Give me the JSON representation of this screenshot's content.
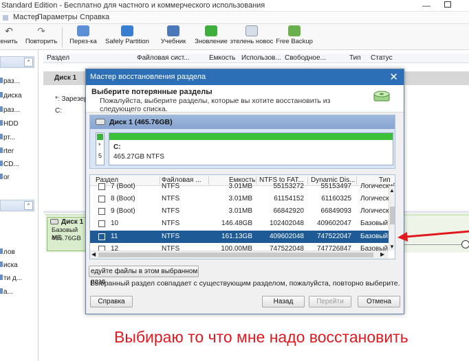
{
  "app": {
    "title": "Standard Edition - Бесплатно для частного и коммерческого использования",
    "menu": [
      "Мастер",
      "Параметры",
      "Справка"
    ],
    "toolbar": [
      "енить",
      "Повторить",
      "Перез-ка",
      "Safely Partition",
      "Учебник",
      "Зновление",
      "зтелень новос",
      "Free Backup"
    ]
  },
  "left_panel": {
    "top_items": [
      "раз...",
      "диска",
      "раз...",
      "HDD",
      "рт...",
      "rter",
      "CD...",
      "or"
    ],
    "bottom_items": [
      "лов",
      "иска",
      "ти д...",
      "а..."
    ]
  },
  "grid": {
    "columns": [
      "Раздел",
      "Файловая сист...",
      "Емкость",
      "Использов...",
      "Свободное...",
      "Тип",
      "Статус"
    ],
    "disk_label": "Диск 1",
    "reserved": "*: Зарезер",
    "c_label": "C:"
  },
  "disk_map": {
    "title": "Диск 1",
    "type": "Базовый МБ",
    "size": "465.76GB"
  },
  "dialog": {
    "title": "Мастер восстановления раздела",
    "heading": "Выберите потерянные разделы",
    "instruction": "Пожалуйста, выберите разделы, которые вы хотите восстановить из следующего списка.",
    "disk_header": "Диск 1 (465.76GB)",
    "left_box": [
      "*",
      "5"
    ],
    "partition_label": "C:",
    "partition_info": "465.27GB NTFS",
    "table_columns": [
      "Раздел",
      "Файловая ...",
      "Емкость",
      "NTFS to FAT...",
      "Dynamic Dis...",
      "Тип"
    ],
    "rows": [
      {
        "name": "7 (Boot)",
        "fs": "NTFS",
        "size": "3.01MB",
        "ntfs": "55153272",
        "dyn": "55153497",
        "type": "Логический",
        "selected": false
      },
      {
        "name": "8 (Boot)",
        "fs": "NTFS",
        "size": "3.01MB",
        "ntfs": "61154152",
        "dyn": "61160325",
        "type": "Логический",
        "selected": false
      },
      {
        "name": "9 (Boot)",
        "fs": "NTFS",
        "size": "3.01MB",
        "ntfs": "66842920",
        "dyn": "66849093",
        "type": "Логический",
        "selected": false
      },
      {
        "name": "10",
        "fs": "NTFS",
        "size": "146.48GB",
        "ntfs": "102402048",
        "dyn": "409602047",
        "type": "Базовый",
        "selected": false
      },
      {
        "name": "11",
        "fs": "NTFS",
        "size": "161.13GB",
        "ntfs": "409602048",
        "dyn": "747522047",
        "type": "Базовый",
        "selected": true
      },
      {
        "name": "12",
        "fs": "NTFS",
        "size": "100.00MB",
        "ntfs": "747522048",
        "dyn": "747726847",
        "type": "Базовый",
        "selected": false
      }
    ],
    "browse_button": "едуйте файлы в этом выбранном разд",
    "warning": "Выбранный раздел совпадает с существующим разделом, пожалуйста, повторно выберите.",
    "buttons": {
      "help": "Справка",
      "back": "Назад",
      "next": "Перейти",
      "cancel": "Отмена"
    }
  },
  "annotation": {
    "caption": "Выбираю то что мне надо восстановить",
    "color": "#e0191f"
  }
}
